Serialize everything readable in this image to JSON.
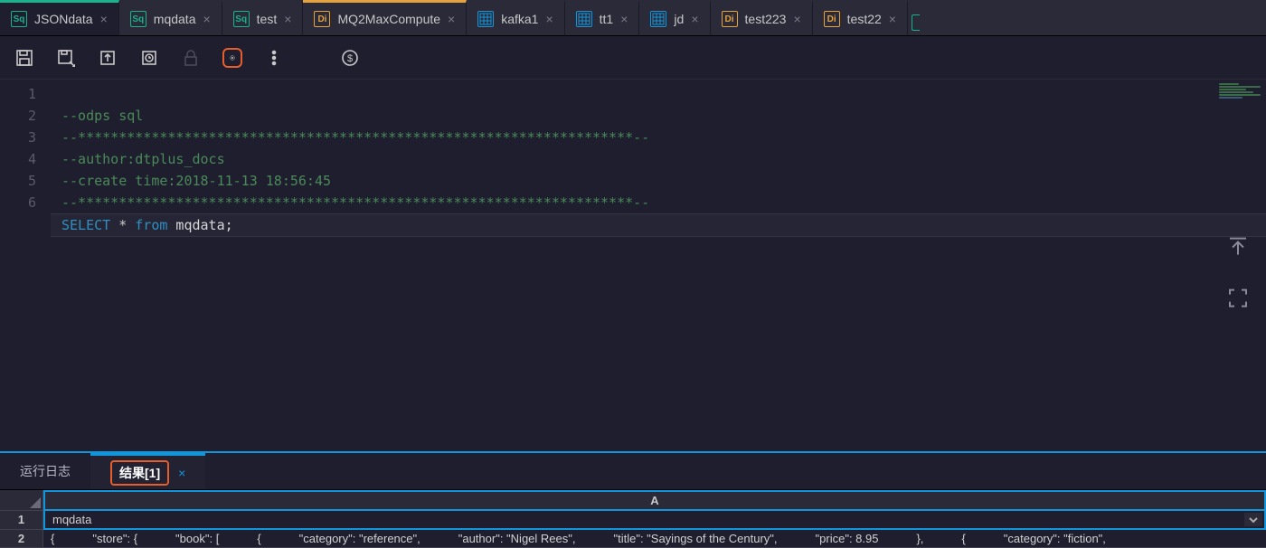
{
  "tabs": [
    {
      "icon": "sq",
      "label": "JSONdata"
    },
    {
      "icon": "sq",
      "label": "mqdata"
    },
    {
      "icon": "sq",
      "label": "test"
    },
    {
      "icon": "di",
      "label": "MQ2MaxCompute"
    },
    {
      "icon": "tbl",
      "label": "kafka1"
    },
    {
      "icon": "tbl",
      "label": "tt1"
    },
    {
      "icon": "tbl",
      "label": "jd"
    },
    {
      "icon": "di",
      "label": "test223"
    },
    {
      "icon": "di",
      "label": "test22"
    }
  ],
  "tab_icon_text": {
    "sq": "Sq",
    "di": "Di",
    "tbl": ""
  },
  "editor": {
    "lines": {
      "l1": "--odps sql",
      "l2": "--********************************************************************--",
      "l3": "--author:dtplus_docs",
      "l4": "--create time:2018-11-13 18:56:45",
      "l5": "--********************************************************************--",
      "l6_kw1": "SELECT",
      "l6_star": " * ",
      "l6_kw2": "from",
      "l6_ident": " mqdata;"
    },
    "line_numbers": [
      "1",
      "2",
      "3",
      "4",
      "5",
      "6"
    ]
  },
  "bottom": {
    "tab_log": "运行日志",
    "tab_result": "结果[1]"
  },
  "result": {
    "col_header": "A",
    "rows": {
      "r1_num": "1",
      "r1_val": "mqdata",
      "r2_num": "2",
      "r2": {
        "c0": "{",
        "c1": "\"store\": {",
        "c2": "\"book\": [",
        "c3": "{",
        "c4": "\"category\": \"reference\",",
        "c5": "\"author\": \"Nigel Rees\",",
        "c6": "\"title\": \"Sayings of the Century\",",
        "c7": "\"price\": 8.95",
        "c8": "},",
        "c9": "{",
        "c10": "\"category\": \"fiction\","
      }
    }
  }
}
